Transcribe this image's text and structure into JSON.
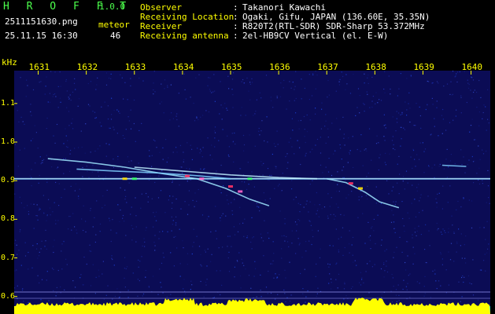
{
  "header": {
    "app_title": "H R O F F T",
    "version": "1.0.0",
    "filename": "2511151630.png",
    "datetime": "25.11.15 16:30",
    "meteor_label": "meteor",
    "meteor_count": "46",
    "info": [
      {
        "label": "Observer",
        "sep": ":",
        "value": "Takanori Kawachi"
      },
      {
        "label": "Receiving Location",
        "sep": ":",
        "value": "Ogaki, Gifu, JAPAN (136.60E, 35.35N)"
      },
      {
        "label": "Receiver",
        "sep": ":",
        "value": "R820T2(RTL-SDR) SDR-Sharp 53.372MHz"
      },
      {
        "label": "Receiving antenna",
        "sep": ":",
        "value": "2el-HB9CV Vertical (el. E-W)"
      }
    ]
  },
  "colors": {
    "title_green": "#4cff4c",
    "label_yellow": "#ffff00",
    "background": "#000000",
    "plot_bg": "#0b0c55",
    "spectrum_yellow": "#ffff00",
    "spectrum_cyan": "#00d0ff"
  },
  "chart_data": {
    "type": "heatmap",
    "ylabel": "kHz",
    "x_ticks": [
      "1631",
      "1632",
      "1633",
      "1634",
      "1635",
      "1636",
      "1637",
      "1638",
      "1639",
      "1640"
    ],
    "y_ticks": [
      "1.1",
      "1.0",
      "0.9",
      "0.8",
      "0.7",
      "0.6"
    ],
    "xlim": [
      1630.5,
      1640.4
    ],
    "ylim": [
      0.575,
      1.185
    ],
    "carrier_khz": 0.905,
    "echoes": [
      {
        "points": [
          [
            1631.2,
            0.957
          ],
          [
            1632.0,
            0.948
          ],
          [
            1632.8,
            0.935
          ],
          [
            1633.6,
            0.918
          ],
          [
            1634.3,
            0.905
          ],
          [
            1634.9,
            0.88
          ],
          [
            1635.4,
            0.852
          ],
          [
            1635.8,
            0.835
          ]
        ]
      },
      {
        "points": [
          [
            1631.8,
            0.93
          ],
          [
            1632.6,
            0.925
          ],
          [
            1633.5,
            0.92
          ],
          [
            1634.4,
            0.912
          ],
          [
            1635.0,
            0.905
          ]
        ]
      },
      {
        "points": [
          [
            1633.0,
            0.935
          ],
          [
            1634.0,
            0.925
          ],
          [
            1635.0,
            0.915
          ],
          [
            1636.0,
            0.908
          ],
          [
            1636.8,
            0.905
          ]
        ]
      },
      {
        "points": [
          [
            1637.0,
            0.905
          ],
          [
            1637.4,
            0.895
          ],
          [
            1637.8,
            0.87
          ],
          [
            1638.1,
            0.845
          ],
          [
            1638.5,
            0.83
          ]
        ]
      },
      {
        "points": [
          [
            1639.4,
            0.94
          ],
          [
            1639.9,
            0.937
          ]
        ]
      }
    ]
  }
}
